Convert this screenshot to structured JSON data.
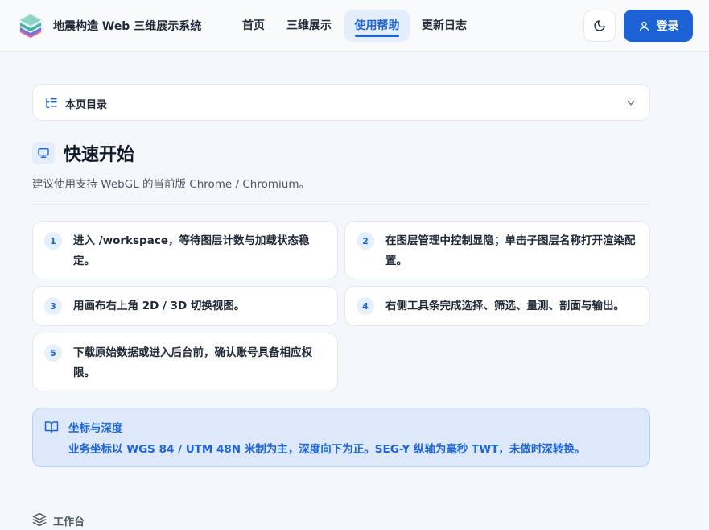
{
  "header": {
    "app_title": "地震构造 Web 三维展示系统",
    "nav": [
      {
        "label": "首页",
        "active": false
      },
      {
        "label": "三维展示",
        "active": false
      },
      {
        "label": "使用帮助",
        "active": true
      },
      {
        "label": "更新日志",
        "active": false
      }
    ],
    "theme_icon": "moon-icon",
    "login_label": "登录",
    "login_icon": "user-icon"
  },
  "toc": {
    "label": "本页目录",
    "icon": "list-tree-icon",
    "expand_icon": "chevron-down-icon"
  },
  "quick_start": {
    "icon": "monitor-icon",
    "title": "快速开始",
    "subtitle": "建议使用支持 WebGL 的当前版 Chrome / Chromium。",
    "steps": [
      {
        "num": "1",
        "text": "进入 /workspace，等待图层计数与加载状态稳定。"
      },
      {
        "num": "2",
        "text": "在图层管理中控制显隐；单击子图层名称打开渲染配置。"
      },
      {
        "num": "3",
        "text": "用画布右上角 2D / 3D 切换视图。"
      },
      {
        "num": "4",
        "text": "右侧工具条完成选择、筛选、量测、剖面与输出。"
      },
      {
        "num": "5",
        "text": "下载原始数据或进入后台前，确认账号具备相应权限。"
      }
    ]
  },
  "note": {
    "icon": "book-open-icon",
    "title": "坐标与深度",
    "body": "业务坐标以 WGS 84 / UTM 48N 米制为主，深度向下为正。SEG-Y 纵轴为毫秒 TWT，未做时深转换。"
  },
  "workspace": {
    "icon": "layers-icon",
    "label": "工作台"
  },
  "colors": {
    "accent": "#1d64d6",
    "note_bg": "#dde9fb",
    "page_bg": "#f4f7fb"
  }
}
